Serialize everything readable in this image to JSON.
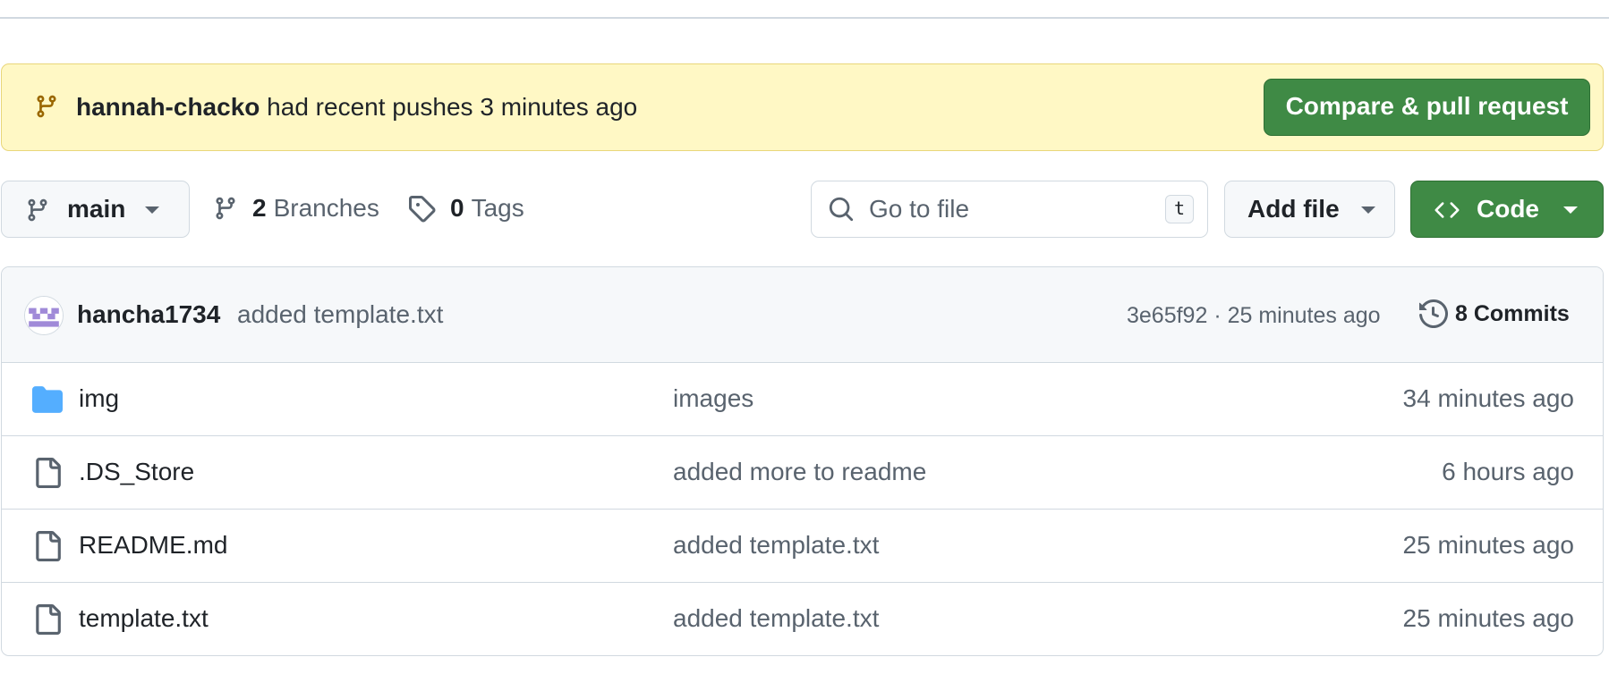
{
  "banner": {
    "user": "hannah-chacko",
    "message": "had recent pushes 3 minutes ago",
    "button_label": "Compare & pull request"
  },
  "toolbar": {
    "branch_name": "main",
    "branches_count": "2",
    "branches_label": "Branches",
    "tags_count": "0",
    "tags_label": "Tags",
    "search_placeholder": "Go to file",
    "search_shortcut": "t",
    "add_file_label": "Add file",
    "code_label": "Code"
  },
  "latest_commit": {
    "author": "hancha1734",
    "message": "added template.txt",
    "meta": "3e65f92 · 25 minutes ago",
    "commits_label": "8 Commits"
  },
  "files": [
    {
      "type": "folder",
      "icon": "folder-icon",
      "name": "img",
      "message": "images",
      "time": "34 minutes ago"
    },
    {
      "type": "file",
      "icon": "file-icon",
      "name": ".DS_Store",
      "message": "added more to readme",
      "time": "6 hours ago"
    },
    {
      "type": "file",
      "icon": "file-icon",
      "name": "README.md",
      "message": "added template.txt",
      "time": "25 minutes ago"
    },
    {
      "type": "file",
      "icon": "file-icon",
      "name": "template.txt",
      "message": "added template.txt",
      "time": "25 minutes ago"
    }
  ],
  "colors": {
    "banner_bg": "#fff8c5",
    "primary_green": "#3f8a45",
    "folder_blue": "#54aeff",
    "muted_text": "#59636e",
    "border": "#d1d9e0"
  }
}
